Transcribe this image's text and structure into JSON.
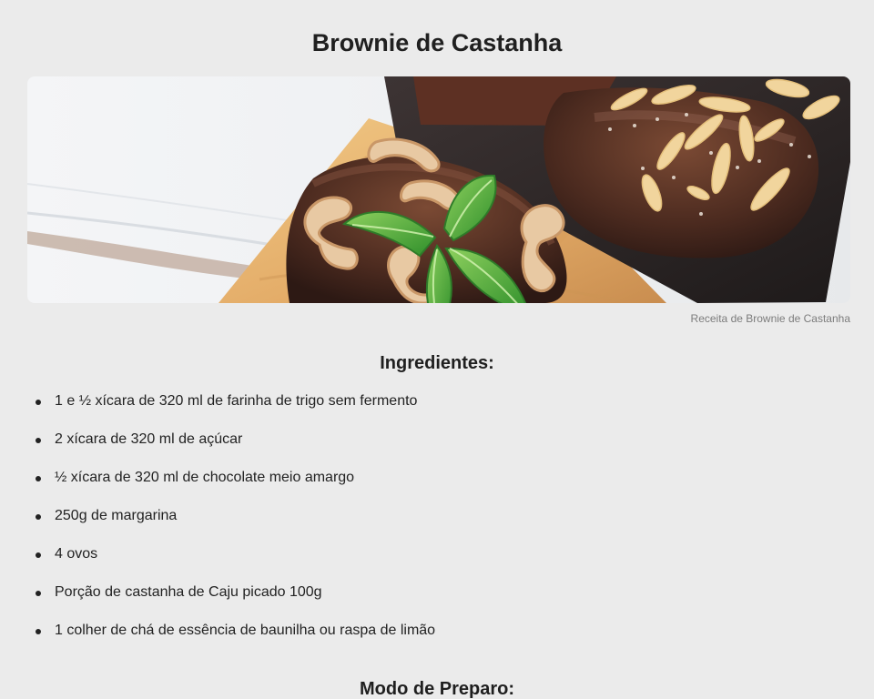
{
  "recipe": {
    "title": "Brownie de Castanha",
    "image_caption": "Receita de Brownie de Castanha",
    "ingredients_heading": "Ingredientes:",
    "ingredients": [
      "1 e ½ xícara de 320 ml de farinha de trigo sem fermento",
      "2 xícara de 320 ml de açúcar",
      "½ xícara de 320 ml de chocolate meio amargo",
      "250g de margarina",
      "4 ovos",
      "Porção de castanha de Caju picado 100g",
      "1 colher de chá de essência de baunilha ou raspa de limão"
    ],
    "method_heading": "Modo de Preparo:"
  },
  "colors": {
    "page_background": "#ebebeb",
    "text": "#1f1f1f",
    "caption": "#7c7c7c"
  },
  "image": {
    "subject": "brownie-with-cashews-mint-and-almond-slices"
  }
}
